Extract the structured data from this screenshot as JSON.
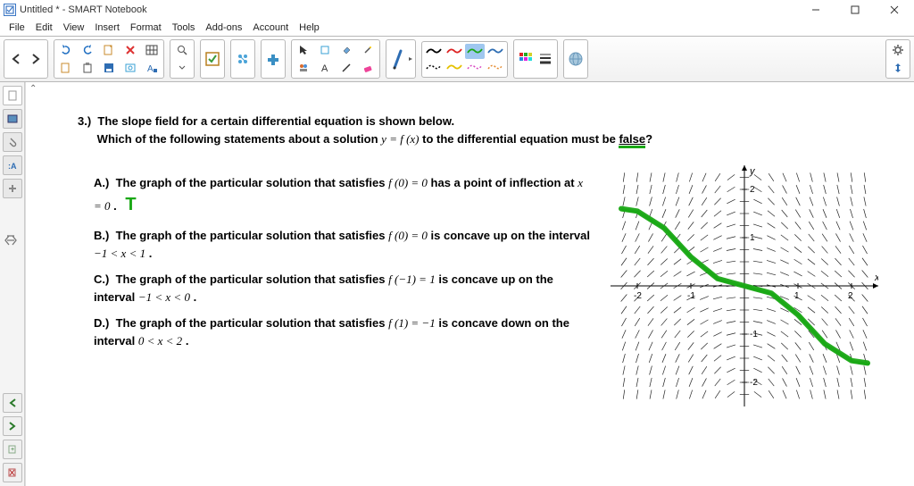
{
  "window": {
    "title": "Untitled * - SMART Notebook"
  },
  "menu": [
    "File",
    "Edit",
    "View",
    "Insert",
    "Format",
    "Tools",
    "Add-ons",
    "Account",
    "Help"
  ],
  "toolbar": {
    "nav_back": "Back",
    "nav_fwd": "Forward",
    "undo": "Undo",
    "redo": "Redo",
    "new_page": "New Page",
    "delete": "Delete",
    "table": "Table",
    "open": "Open",
    "paste": "Paste",
    "save": "Save",
    "screen_capture": "Capture",
    "doc_cam": "DocCam",
    "zoom": "Zoom",
    "response": "Response",
    "activity": "Activity",
    "add_on": "Add-on",
    "select": "Select",
    "shape_pen": "Shape Pen",
    "fill": "Fill",
    "magic": "Magic Pen",
    "two_page": "Dual Page",
    "text": "Text",
    "line": "Line",
    "eraser": "Eraser",
    "pen": "Pen",
    "color_picker": "Color",
    "props": "Properties",
    "globe": "Share",
    "settings": "Settings",
    "move_toolbar": "Move"
  },
  "question": {
    "number": "3.)",
    "stem1": "The slope field for a certain differential equation is shown below.",
    "stem2a": "Which of the following statements about a solution ",
    "stem2_math": "y = f (x)",
    "stem2b": " to the differential equation must be ",
    "stem2_false": "false",
    "stem2_q": "?",
    "options": {
      "A": {
        "label": "A.)",
        "text1": "The graph of the particular solution that satisfies ",
        "math1": "f (0) = 0",
        "text2": " has a point of inflection at ",
        "math2": "x = 0",
        "text3": ".",
        "annot": "T"
      },
      "B": {
        "label": "B.)",
        "text1": "The graph of the particular solution that satisfies ",
        "math1": "f (0) = 0",
        "text2": " is concave up on the interval ",
        "math2": "−1 < x < 1",
        "text3": "."
      },
      "C": {
        "label": "C.)",
        "text1": "The graph of the particular solution that satisfies ",
        "math1": "f (−1) = 1",
        "text2": " is concave up on the interval ",
        "math2": "−1 < x < 0",
        "text3": "."
      },
      "D": {
        "label": "D.)",
        "text1": "The graph of the particular solution that satisfies ",
        "math1": "f (1) = −1",
        "text2": " is concave down on the interval ",
        "math2": "0 < x < 2",
        "text3": "."
      }
    }
  },
  "chart_data": {
    "type": "slope_field",
    "title": "",
    "xlabel": "x",
    "ylabel": "y",
    "xlim": [
      -2.5,
      2.5
    ],
    "ylim": [
      -2.5,
      2.5
    ],
    "xticks": [
      -2,
      -1,
      1,
      2
    ],
    "yticks": [
      -2,
      -1,
      1,
      2
    ],
    "grid_step": 0.25,
    "slope_rule": "dy/dx ≈ -x * (1 + y^2)/2  (slopes are ~0 on the y-axis, negative for x>0, positive for x<0, magnitude grows with |x| and |y|)",
    "solution_curve_through": {
      "x0": 0,
      "y0": 0
    },
    "solution_curve_points": [
      {
        "x": -2.3,
        "y": 1.6
      },
      {
        "x": -2.0,
        "y": 1.55
      },
      {
        "x": -1.5,
        "y": 1.2
      },
      {
        "x": -1.0,
        "y": 0.6
      },
      {
        "x": -0.5,
        "y": 0.15
      },
      {
        "x": 0.0,
        "y": 0.0
      },
      {
        "x": 0.5,
        "y": -0.15
      },
      {
        "x": 1.0,
        "y": -0.6
      },
      {
        "x": 1.5,
        "y": -1.2
      },
      {
        "x": 2.0,
        "y": -1.55
      },
      {
        "x": 2.3,
        "y": -1.6
      }
    ],
    "annotation_pen_color": "#1aa815"
  }
}
